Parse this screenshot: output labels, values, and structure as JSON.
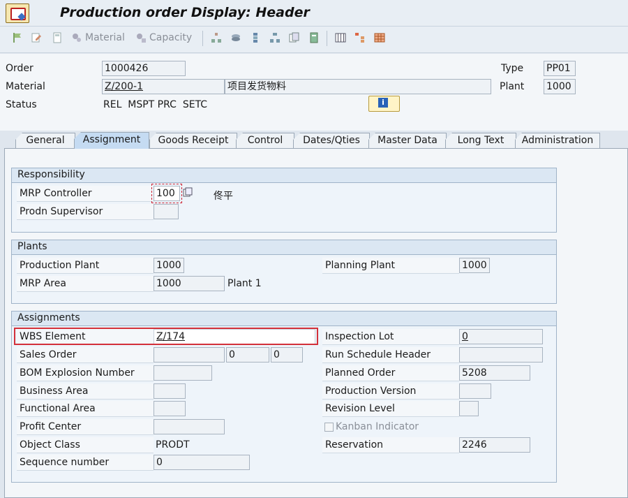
{
  "window": {
    "title": "Production order Display: Header"
  },
  "toolbar": {
    "material_label": "Material",
    "capacity_label": "Capacity"
  },
  "header": {
    "order_label": "Order",
    "order_value": "1000426",
    "type_label": "Type",
    "type_value": "PP01",
    "material_label": "Material",
    "material_value": "Z/200-1",
    "material_desc": "项目发货物料",
    "plant_label": "Plant",
    "plant_value": "1000",
    "status_label": "Status",
    "status_value": "REL  MSPT PRC  SETC"
  },
  "tabs": [
    {
      "label": "General"
    },
    {
      "label": "Assignment"
    },
    {
      "label": "Goods Receipt"
    },
    {
      "label": "Control"
    },
    {
      "label": "Dates/Qties"
    },
    {
      "label": "Master Data"
    },
    {
      "label": "Long Text"
    },
    {
      "label": "Administration"
    }
  ],
  "responsibility": {
    "title": "Responsibility",
    "mrp_controller_label": "MRP Controller",
    "mrp_controller_value": "100",
    "mrp_controller_name": "佟平",
    "prodn_supervisor_label": "Prodn Supervisor",
    "prodn_supervisor_value": ""
  },
  "plants": {
    "title": "Plants",
    "production_plant_label": "Production Plant",
    "production_plant_value": "1000",
    "planning_plant_label": "Planning Plant",
    "planning_plant_value": "1000",
    "mrp_area_label": "MRP Area",
    "mrp_area_value": "1000",
    "mrp_area_desc": "Plant 1"
  },
  "assignments": {
    "title": "Assignments",
    "wbs_label": "WBS Element",
    "wbs_value": "Z/174",
    "inspection_lot_label": "Inspection Lot",
    "inspection_lot_value": "0",
    "sales_order_label": "Sales Order",
    "sales_order_value": "",
    "sales_order_item": "0",
    "sales_order_schedule": "0",
    "run_schedule_label": "Run Schedule Header",
    "run_schedule_value": "",
    "bom_label": "BOM Explosion Number",
    "bom_value": "",
    "planned_order_label": "Planned Order",
    "planned_order_value": "5208",
    "business_area_label": "Business Area",
    "business_area_value": "",
    "production_version_label": "Production Version",
    "production_version_value": "",
    "functional_area_label": "Functional Area",
    "functional_area_value": "",
    "revision_level_label": "Revision Level",
    "revision_level_value": "",
    "profit_center_label": "Profit Center",
    "profit_center_value": "",
    "kanban_label": "Kanban Indicator",
    "object_class_label": "Object Class",
    "object_class_value": "PRODT",
    "reservation_label": "Reservation",
    "reservation_value": "2246",
    "sequence_label": "Sequence number",
    "sequence_value": "0"
  },
  "colors": {
    "highlight": "#d3303a",
    "active_tab": "#c5dbf2"
  }
}
